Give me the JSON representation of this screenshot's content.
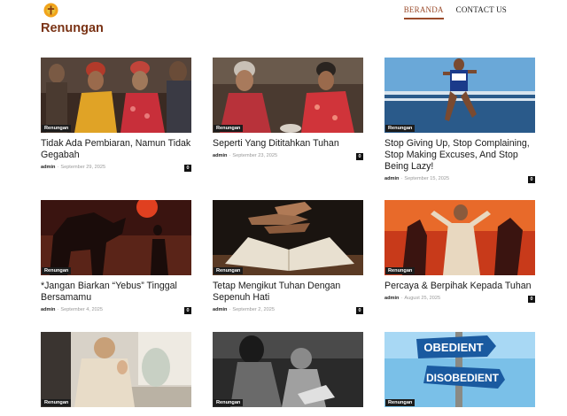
{
  "header": {
    "logo_icon": "sun-cross-logo",
    "nav": [
      {
        "label": "BERANDA",
        "active": true
      },
      {
        "label": "CONTACT US",
        "active": false
      }
    ]
  },
  "page": {
    "title": "Renungan"
  },
  "posts": [
    {
      "title": "Tidak Ada Pembiaran, Namun Tidak Gegabah",
      "category": "Renungan",
      "author": "admin",
      "date": "September 29, 2025",
      "comments": "0"
    },
    {
      "title": "Seperti Yang Dititahkan Tuhan",
      "category": "Renungan",
      "author": "admin",
      "date": "September 23, 2025",
      "comments": "0"
    },
    {
      "title": "Stop Giving Up, Stop Complaining, Stop Making Excuses, And Stop Being Lazy!",
      "category": "Renungan",
      "author": "admin",
      "date": "September 15, 2025",
      "comments": "0"
    },
    {
      "title": "*Jangan Biarkan “Yebus” Tinggal Bersamamu",
      "category": "Renungan",
      "author": "admin",
      "date": "September 4, 2025",
      "comments": "0"
    },
    {
      "title": "Tetap Mengikut Tuhan Dengan Sepenuh Hati",
      "category": "Renungan",
      "author": "admin",
      "date": "September 2, 2025",
      "comments": "0"
    },
    {
      "title": "Percaya & Berpihak Kepada Tuhan",
      "category": "Renungan",
      "author": "admin",
      "date": "August 25, 2025",
      "comments": "0"
    },
    {
      "title": "",
      "category": "Renungan",
      "author": "",
      "date": "",
      "comments": ""
    },
    {
      "title": "",
      "category": "Renungan",
      "author": "",
      "date": "",
      "comments": ""
    },
    {
      "title": "",
      "category": "Renungan",
      "author": "",
      "date": "",
      "comments": ""
    }
  ],
  "images": {
    "sign_obedient": "OBEDIENT",
    "sign_disobedient": "DISOBEDIENT"
  }
}
